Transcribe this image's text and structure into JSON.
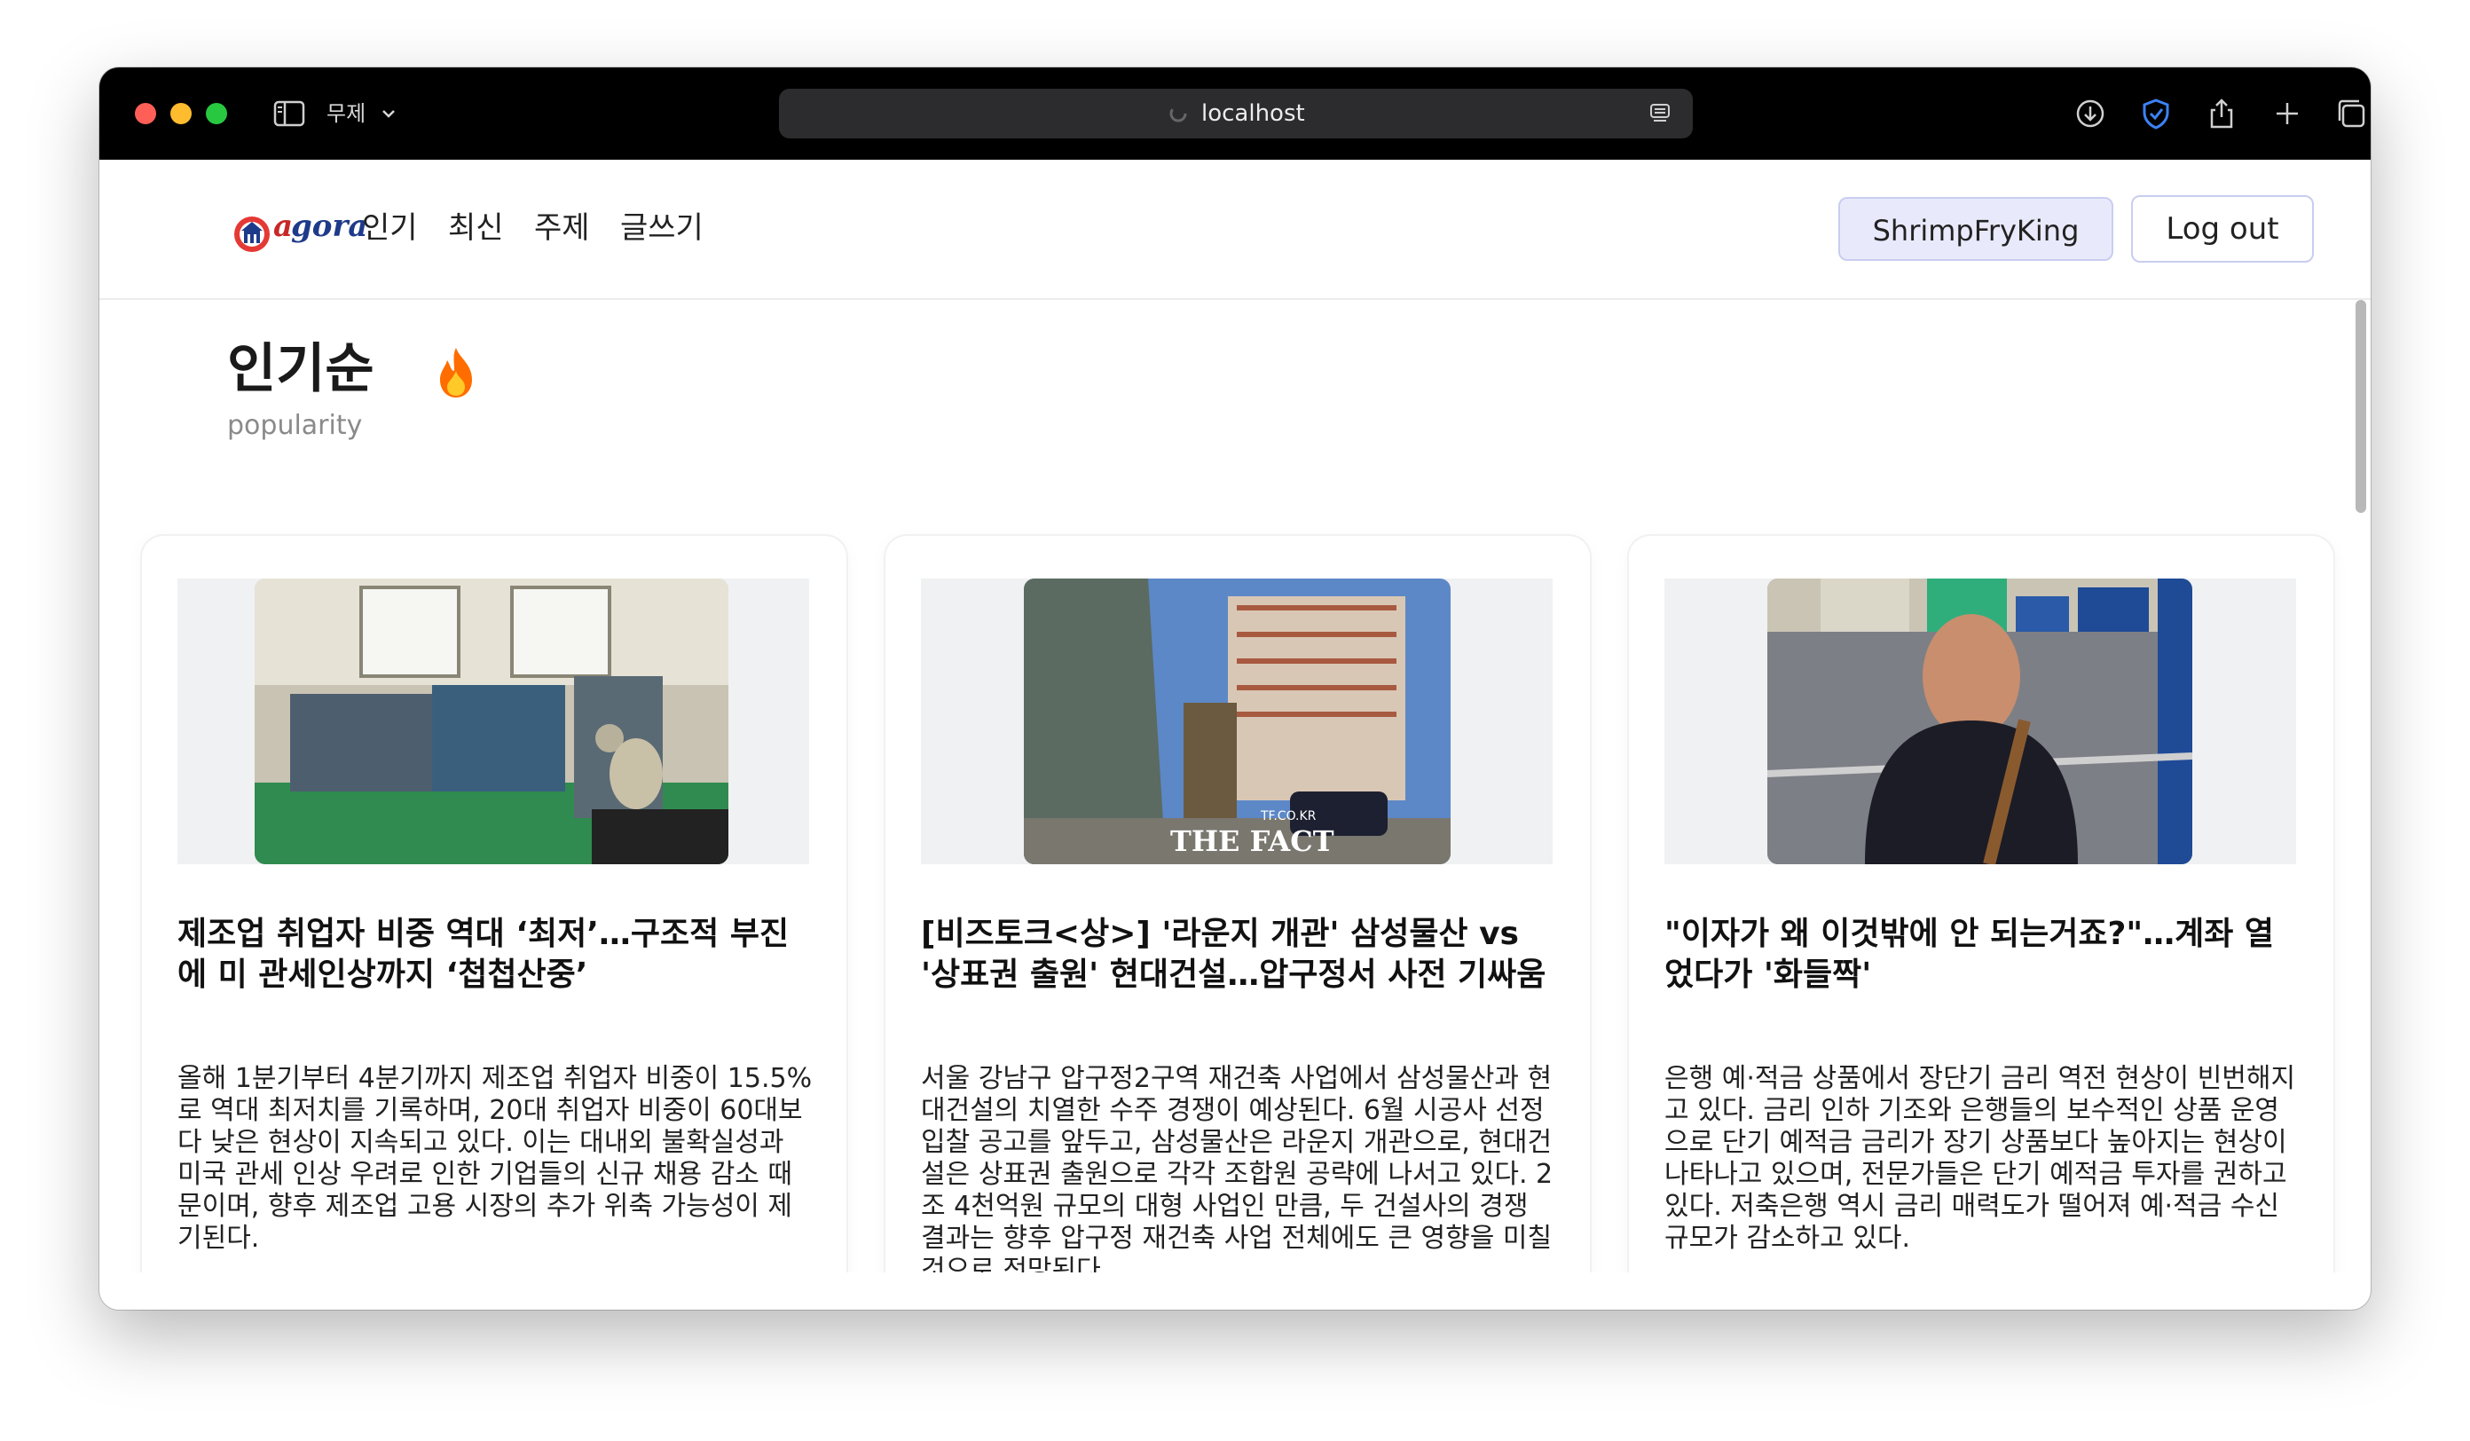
{
  "browser": {
    "tab_group_label": "무제",
    "url": "localhost"
  },
  "navbar": {
    "logo_text": "agora",
    "links": [
      "인기",
      "최신",
      "주제",
      "글쓰기"
    ],
    "user_label": "ShrimpFryKing",
    "logout_label": "Log out"
  },
  "page": {
    "title": "인기순",
    "subtitle": "popularity"
  },
  "articles": [
    {
      "title": "제조업 취업자 비중 역대 ‘최저’…구조적 부진에 미 관세인상까지 ‘첩첩산중’",
      "summary": "올해 1분기부터 4분기까지 제조업 취업자 비중이 15.5%로 역대 최저치를 기록하며, 20대 취업자 비중이 60대보다 낮은 현상이 지속되고 있다. 이는 대내외 불확실성과 미국 관세 인상 우려로 인한 기업들의 신규 채용 감소 때문이며, 향후 제조업 고용 시장의 추가 위축 가능성이 제기된다."
    },
    {
      "title": "[비즈토크<상>] '라운지 개관' 삼성물산 vs '상표권 출원' 현대건설…압구정서 사전 기싸움",
      "summary": "서울 강남구 압구정2구역 재건축 사업에서 삼성물산과 현대건설의 치열한 수주 경쟁이 예상된다. 6월 시공사 선정 입찰 공고를 앞두고, 삼성물산은 라운지 개관으로, 현대건설은 상표권 출원으로 각각 조합원 공략에 나서고 있다. 2조 4천억원 규모의 대형 사업인 만큼, 두 건설사의 경쟁 결과는 향후 압구정 재건축 사업 전체에도 큰 영향을 미칠 것으로 전망된다.",
      "image_caption": "THE FACT",
      "image_small_caption": "TF.CO.KR"
    },
    {
      "title": "\"이자가 왜 이것밖에 안 되는거죠?\"…계좌 열었다가 '화들짝'",
      "summary": "은행 예·적금 상품에서 장단기 금리 역전 현상이 빈번해지고 있다. 금리 인하 기조와 은행들의 보수적인 상품 운영으로 단기 예적금 금리가 장기 상품보다 높아지는 현상이 나타나고 있으며, 전문가들은 단기 예적금 투자를 권하고 있다. 저축은행 역시 금리 매력도가 떨어져 예·적금 수신 규모가 감소하고 있다."
    }
  ],
  "icons": [
    "sidebar-icon",
    "chevron-down-icon",
    "loading-icon",
    "reader-icon",
    "download-icon",
    "shield-icon",
    "share-icon",
    "plus-icon",
    "tabs-icon",
    "fire-icon"
  ],
  "colors": {
    "accent": "#e8eafb",
    "title_bar": "#000000",
    "shield": "#3d82f6"
  }
}
